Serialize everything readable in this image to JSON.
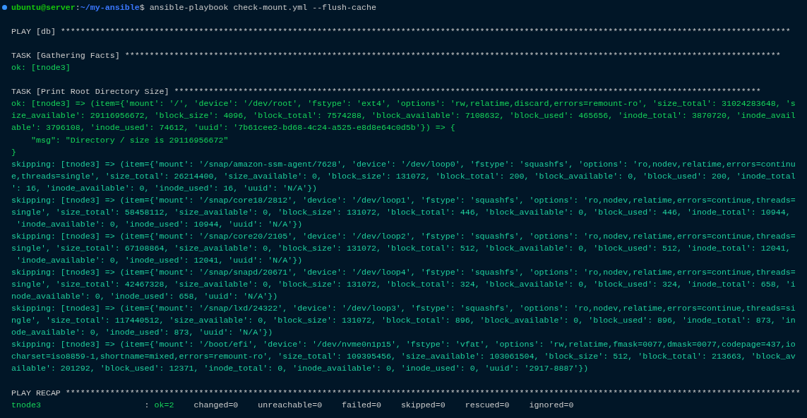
{
  "prompt": {
    "user": "ubuntu@server",
    "separator": ":",
    "path": "~/my-ansible",
    "symbol": "$",
    "command": " ansible-playbook check-mount.yml --flush-cache"
  },
  "lines": [
    {
      "kind": "blank"
    },
    {
      "kind": "header",
      "text": "PLAY [db] ****************************************************************************************************************************************************"
    },
    {
      "kind": "blank"
    },
    {
      "kind": "header",
      "text": "TASK [Gathering Facts] *************************************************************************************************************************************"
    },
    {
      "kind": "ok",
      "text": "ok: [tnode3]"
    },
    {
      "kind": "blank"
    },
    {
      "kind": "header",
      "text": "TASK [Print Root Directory Size] ***********************************************************************************************************************"
    },
    {
      "kind": "ok",
      "text": "ok: [tnode3] => (item={'mount': '/', 'device': '/dev/root', 'fstype': 'ext4', 'options': 'rw,relatime,discard,errors=remount-ro', 'size_total': 31024283648, 's"
    },
    {
      "kind": "ok",
      "text": "ize_available': 29116956672, 'block_size': 4096, 'block_total': 7574288, 'block_available': 7108632, 'block_used': 465656, 'inode_total': 3870720, 'inode_avail"
    },
    {
      "kind": "ok",
      "text": "able': 3796108, 'inode_used': 74612, 'uuid': '7b61cee2-bd68-4c24-a525-e8d8e64c0d5b'}) => {"
    },
    {
      "kind": "ok",
      "text": "    \"msg\": \"Directory / size is 29116956672\""
    },
    {
      "kind": "ok",
      "text": "}"
    },
    {
      "kind": "skip",
      "text": "skipping: [tnode3] => (item={'mount': '/snap/amazon-ssm-agent/7628', 'device': '/dev/loop0', 'fstype': 'squashfs', 'options': 'ro,nodev,relatime,errors=continu"
    },
    {
      "kind": "skip",
      "text": "e,threads=single', 'size_total': 26214400, 'size_available': 0, 'block_size': 131072, 'block_total': 200, 'block_available': 0, 'block_used': 200, 'inode_total"
    },
    {
      "kind": "skip",
      "text": "': 16, 'inode_available': 0, 'inode_used': 16, 'uuid': 'N/A'})"
    },
    {
      "kind": "skip",
      "text": "skipping: [tnode3] => (item={'mount': '/snap/core18/2812', 'device': '/dev/loop1', 'fstype': 'squashfs', 'options': 'ro,nodev,relatime,errors=continue,threads="
    },
    {
      "kind": "skip",
      "text": "single', 'size_total': 58458112, 'size_available': 0, 'block_size': 131072, 'block_total': 446, 'block_available': 0, 'block_used': 446, 'inode_total': 10944,"
    },
    {
      "kind": "skip",
      "text": " 'inode_available': 0, 'inode_used': 10944, 'uuid': 'N/A'})"
    },
    {
      "kind": "skip",
      "text": "skipping: [tnode3] => (item={'mount': '/snap/core20/2105', 'device': '/dev/loop2', 'fstype': 'squashfs', 'options': 'ro,nodev,relatime,errors=continue,threads="
    },
    {
      "kind": "skip",
      "text": "single', 'size_total': 67108864, 'size_available': 0, 'block_size': 131072, 'block_total': 512, 'block_available': 0, 'block_used': 512, 'inode_total': 12041,"
    },
    {
      "kind": "skip",
      "text": " 'inode_available': 0, 'inode_used': 12041, 'uuid': 'N/A'})"
    },
    {
      "kind": "skip",
      "text": "skipping: [tnode3] => (item={'mount': '/snap/snapd/20671', 'device': '/dev/loop4', 'fstype': 'squashfs', 'options': 'ro,nodev,relatime,errors=continue,threads="
    },
    {
      "kind": "skip",
      "text": "single', 'size_total': 42467328, 'size_available': 0, 'block_size': 131072, 'block_total': 324, 'block_available': 0, 'block_used': 324, 'inode_total': 658, 'i"
    },
    {
      "kind": "skip",
      "text": "node_available': 0, 'inode_used': 658, 'uuid': 'N/A'})"
    },
    {
      "kind": "skip",
      "text": "skipping: [tnode3] => (item={'mount': '/snap/lxd/24322', 'device': '/dev/loop3', 'fstype': 'squashfs', 'options': 'ro,nodev,relatime,errors=continue,threads=si"
    },
    {
      "kind": "skip",
      "text": "ngle', 'size_total': 117440512, 'size_available': 0, 'block_size': 131072, 'block_total': 896, 'block_available': 0, 'block_used': 896, 'inode_total': 873, 'in"
    },
    {
      "kind": "skip",
      "text": "ode_available': 0, 'inode_used': 873, 'uuid': 'N/A'})"
    },
    {
      "kind": "skip",
      "text": "skipping: [tnode3] => (item={'mount': '/boot/efi', 'device': '/dev/nvme0n1p15', 'fstype': 'vfat', 'options': 'rw,relatime,fmask=0077,dmask=0077,codepage=437,io"
    },
    {
      "kind": "skip",
      "text": "charset=iso8859-1,shortname=mixed,errors=remount-ro', 'size_total': 109395456, 'size_available': 103061504, 'block_size': 512, 'block_total': 213663, 'block_av"
    },
    {
      "kind": "skip",
      "text": "ailable': 201292, 'block_used': 12371, 'inode_total': 0, 'inode_available': 0, 'inode_used': 0, 'uuid': '2917-8887'})"
    },
    {
      "kind": "blank"
    },
    {
      "kind": "header",
      "text": "PLAY RECAP *****************************************************************************************************************************************************"
    }
  ],
  "recap": {
    "host": "tnode3",
    "separator": "                     : ",
    "ok": "ok=2",
    "rest": "    changed=0    unreachable=0    failed=0    skipped=0    rescued=0    ignored=0"
  }
}
